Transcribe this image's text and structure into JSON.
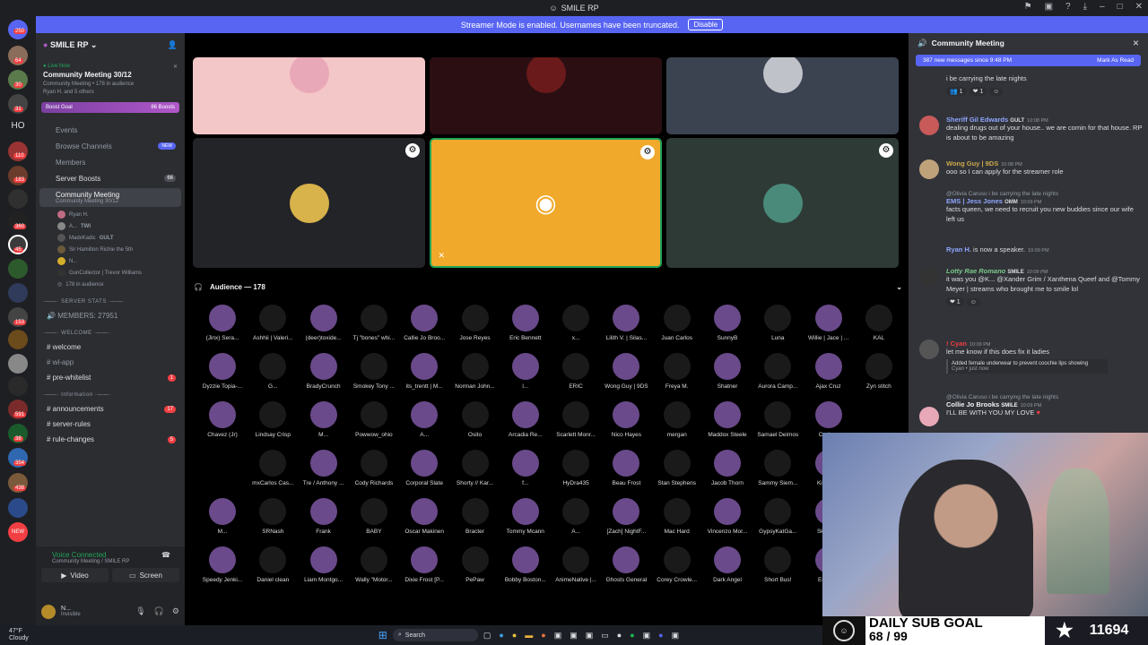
{
  "window": {
    "title": "SMILE RP"
  },
  "banner": {
    "text": "Streamer Mode is enabled. Usernames have been truncated.",
    "button": "Disable"
  },
  "rail": {
    "badges": [
      "250",
      "64",
      "30",
      "",
      "31",
      "",
      "110",
      "183",
      "",
      "360",
      "",
      "45",
      "",
      "153",
      "",
      "",
      "591",
      "38",
      "354",
      "438",
      "NEW"
    ],
    "ho_label": "HO"
  },
  "server": {
    "name": "SMILE RP"
  },
  "live": {
    "status": "Live Now",
    "title": "Community Meeting 30/12",
    "channel": "Community Meeting",
    "audience_inline": "178 in audience",
    "participants": "Ryan H. and 5 others"
  },
  "boost": {
    "label": "Boost Goal",
    "count": "86 Boosts"
  },
  "nav": [
    {
      "label": "Events"
    },
    {
      "label": "Browse Channels",
      "pill": "NEW"
    },
    {
      "label": "Members"
    },
    {
      "label": "Server Boosts",
      "count": "66"
    }
  ],
  "active_channel": {
    "name": "Community Meeting",
    "sub": "Community Meeting 30/12"
  },
  "voice_users": [
    {
      "name": "Ryan H."
    },
    {
      "name": "A...",
      "tag": "TWI"
    },
    {
      "name": "MadxKadic",
      "tag": "GULT"
    },
    {
      "name": "Sir Hamilton Richie the 5th"
    },
    {
      "name": "N..."
    },
    {
      "name": "GunCollector | Trevor Williams"
    },
    {
      "name": "178 in audience"
    }
  ],
  "categories": {
    "server_stats": "SERVER STATS",
    "members": "MEMBERS: 27951",
    "welcome": "WELCOME",
    "information": "Information"
  },
  "channels": [
    {
      "label": "welcome",
      "badge": ""
    },
    {
      "label": "wl-app",
      "badge": ""
    },
    {
      "label": "pre-whitelist",
      "badge": "1"
    },
    {
      "label": "announcements",
      "badge": "17"
    },
    {
      "label": "server-rules",
      "badge": ""
    },
    {
      "label": "rule-changes",
      "badge": "5"
    }
  ],
  "voice_panel": {
    "status": "Voice Connected",
    "location": "Community Meeting / SMILE RP",
    "video": "Video",
    "screen": "Screen"
  },
  "user_panel": {
    "name": "N...",
    "status": "Invisible"
  },
  "audience": {
    "header": "Audience — 178"
  },
  "audience_members": [
    "(Jinx) Sera...",
    "Ashhii | Valeri...",
    "(deer)toxide...",
    "Tj \"bones\" whi...",
    "Callie Jo Broo...",
    "Jose Reyes",
    "Eric Bennett",
    "x...",
    "Lilith V. | Silas...",
    "Juan Carlos",
    "SunnyB",
    "Luna",
    "Willie | Jace | ...",
    "KAL",
    "Dyzzie Topia-...",
    "G...",
    "BradyCrunch",
    "Smokey Tony ...",
    "its_trentt | M...",
    "Norman John...",
    "l...",
    "ERIC",
    "Wong Guy | 9DS",
    "Freya M.",
    "Shatner",
    "Aurora Camp...",
    "Ajax Cruz",
    "Zyn stitch",
    "Chavez (Jr)",
    "Lindsay Crisp",
    "M...",
    "Powwow_ohio",
    "A...",
    "Osito",
    "Arcadia Re...",
    "Scarlett Monr...",
    "Nico Hayes",
    "mergan",
    "Maddox Steele",
    "Samael Deimos",
    "Cyclo...",
    "",
    "",
    "mxCarlos Cas...",
    "Tre / Anthony ...",
    "Cody Richards",
    "Corporal Slate",
    "Shorty // Kar...",
    "f...",
    "HyDra435",
    "Beau Frost",
    "Stan Stephens",
    "Jacob Thorn",
    "Sammy Siem...",
    "Kirby F...",
    "",
    "M...",
    "SRNash",
    "Frank",
    "BABY",
    "Oscar Makinen",
    "Bracter",
    "Tommy Mcann",
    "A...",
    "[Zach] NightF...",
    "Mac Hard",
    "Vincenzo Mor...",
    "GypsyKatGa...",
    "Skylar ...",
    "",
    "Speedy Jenki...",
    "Daniel clean",
    "Liam Montgo...",
    "Wally \"Motor...",
    "Dixie Frost [P...",
    "PePaw",
    "Bobby Boston...",
    "AnimeNative |...",
    "Ghosts General",
    "Corey Crowle...",
    "Dark Angel",
    "Short Bus!",
    "Eric C...",
    ""
  ],
  "chat": {
    "title": "Community Meeting",
    "new_messages": "387 new messages since 9:48 PM",
    "mark_read": "Mark As Read",
    "messages": [
      {
        "name": "",
        "time": "",
        "text": "i be carrying the late nights",
        "reactions": "1   1"
      },
      {
        "name": "Sheriff Gil Edwards",
        "time": "10:08 PM",
        "text": "dealing drugs out of your house.. we are comin for that house. RP is about to be amazing",
        "tag": "GULT"
      },
      {
        "name": "Wong Guy | 9DS",
        "time": "10:08 PM",
        "text": "ooo so I can apply for the streamer role"
      },
      {
        "name": "EMS | Jess Jones",
        "time": "10:09 PM",
        "reply": "@Olivia Caruso i be carrying the late nights",
        "text": "facts queen, we need to recruit you new buddies since our wife left us",
        "tag": "OMM"
      },
      {
        "name": "Ryan H.",
        "time": "10:09 PM",
        "text": "is now a speaker."
      },
      {
        "name": "Lotty Rae Romano",
        "time": "10:09 PM",
        "text": "it was you @K...  @Xander Grim / Xanthena Queef and @Tommy Meyer |  streams who brought me to smile lol",
        "tag": "SMILE"
      },
      {
        "name": "! Cyan",
        "time": "10:09 PM",
        "text": "let me know if this does fix it ladies",
        "embed": "Added female underwear to prevent coochie lips showing",
        "embed_sub": "Cyan • just now"
      },
      {
        "name": "Collie Jo Brooks",
        "time": "10:09 PM",
        "reply": "@Olivia Caruso i be carrying the late nights",
        "text": "I'LL BE WITH YOU MY LOVE",
        "tag": "SMILE"
      }
    ]
  },
  "sub_goal": {
    "title": "DAILY SUB GOAL",
    "progress": "68 / 99",
    "count": "11694"
  },
  "taskbar": {
    "temp": "47°F",
    "weather": "Cloudy",
    "search": "Search"
  }
}
